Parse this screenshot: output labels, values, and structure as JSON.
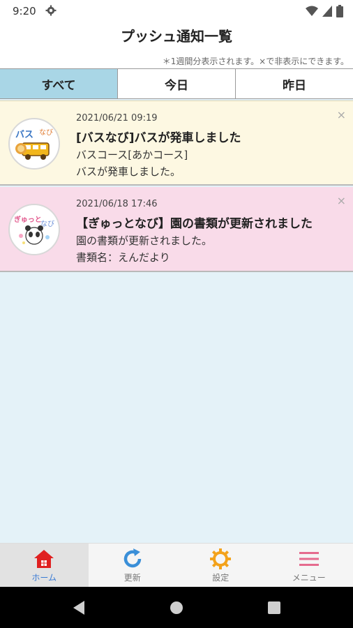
{
  "status": {
    "time": "9:20"
  },
  "header": {
    "title": "プッシュ通知一覧",
    "hint": "＊1週間分表示されます。×で非表示にできます。"
  },
  "tabs": [
    {
      "label": "すべて",
      "active": true
    },
    {
      "label": "今日",
      "active": false
    },
    {
      "label": "昨日",
      "active": false
    }
  ],
  "notifications": [
    {
      "date": "2021/06/21 09:19",
      "title": "[バスなび]バスが発車しました",
      "line1": "バスコース[あかコース]",
      "line2": "バスが発車しました。",
      "background": "#fdf8e2",
      "icon": "bus-navi-logo",
      "logo_text": "バスなび"
    },
    {
      "date": "2021/06/18 17:46",
      "title": "【ぎゅっとなび】園の書類が更新されました",
      "line1": "園の書類が更新されました。",
      "line2": "書類名：えんだより",
      "background": "#f9dbe9",
      "icon": "gyutto-navi-logo",
      "logo_text": "ぎゅっとなび"
    }
  ],
  "close_symbol": "×",
  "bottom_nav": [
    {
      "label": "ホーム",
      "icon": "home-icon",
      "active": true
    },
    {
      "label": "更新",
      "icon": "refresh-icon",
      "active": false
    },
    {
      "label": "設定",
      "icon": "gear-icon",
      "active": false
    },
    {
      "label": "メニュー",
      "icon": "menu-icon",
      "active": false
    }
  ],
  "colors": {
    "tab_active": "#a9d6e6",
    "content_bg": "#e4f2f8",
    "home_red": "#e02020",
    "refresh_blue": "#3a8fd8",
    "gear_orange": "#f3a21b",
    "menu_pink": "#e56b8e"
  }
}
